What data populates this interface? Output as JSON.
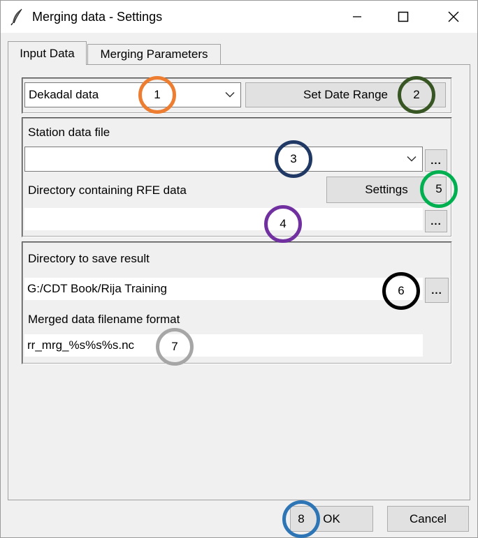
{
  "window": {
    "title": "Merging data - Settings",
    "icon": "feather-icon"
  },
  "tabs": [
    {
      "label": "Input Data",
      "active": true
    },
    {
      "label": "Merging Parameters",
      "active": false
    }
  ],
  "time_step": {
    "selected": "Dekadal data",
    "set_date_range_label": "Set Date Range"
  },
  "station": {
    "label": "Station data file",
    "value": "",
    "browse_label": "..."
  },
  "rfe": {
    "label": "Directory containing RFE data",
    "settings_label": "Settings",
    "value": "",
    "browse_label": "..."
  },
  "output": {
    "dir_label": "Directory to save result",
    "dir_value": "G:/CDT Book/Rija Training",
    "browse_label": "...",
    "format_label": "Merged data filename format",
    "format_value": "rr_mrg_%s%s%s.nc"
  },
  "buttons": {
    "ok_label": "OK",
    "cancel_label": "Cancel"
  },
  "markers": [
    {
      "number": "1",
      "color": "#ed7d31"
    },
    {
      "number": "2",
      "color": "#375623"
    },
    {
      "number": "3",
      "color": "#1f3864"
    },
    {
      "number": "4",
      "color": "#7030a0"
    },
    {
      "number": "5",
      "color": "#00b050"
    },
    {
      "number": "6",
      "color": "#000000"
    },
    {
      "number": "7",
      "color": "#a6a6a6"
    },
    {
      "number": "8",
      "color": "#2e75b6"
    }
  ]
}
